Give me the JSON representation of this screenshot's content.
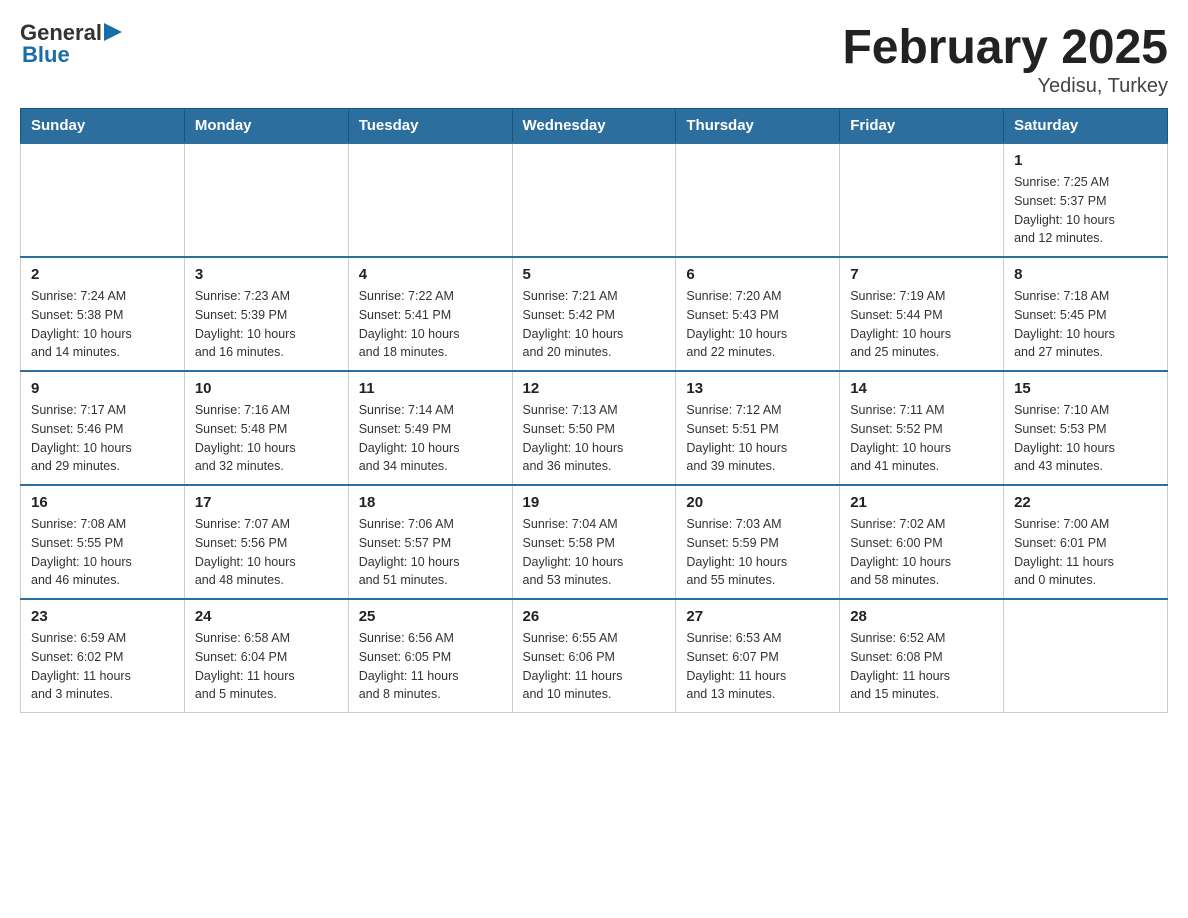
{
  "header": {
    "logo": {
      "general": "General",
      "blue": "Blue",
      "arrow": "▶"
    },
    "title": "February 2025",
    "subtitle": "Yedisu, Turkey"
  },
  "calendar": {
    "days_of_week": [
      "Sunday",
      "Monday",
      "Tuesday",
      "Wednesday",
      "Thursday",
      "Friday",
      "Saturday"
    ],
    "weeks": [
      {
        "days": [
          {
            "number": "",
            "info": ""
          },
          {
            "number": "",
            "info": ""
          },
          {
            "number": "",
            "info": ""
          },
          {
            "number": "",
            "info": ""
          },
          {
            "number": "",
            "info": ""
          },
          {
            "number": "",
            "info": ""
          },
          {
            "number": "1",
            "info": "Sunrise: 7:25 AM\nSunset: 5:37 PM\nDaylight: 10 hours\nand 12 minutes."
          }
        ]
      },
      {
        "days": [
          {
            "number": "2",
            "info": "Sunrise: 7:24 AM\nSunset: 5:38 PM\nDaylight: 10 hours\nand 14 minutes."
          },
          {
            "number": "3",
            "info": "Sunrise: 7:23 AM\nSunset: 5:39 PM\nDaylight: 10 hours\nand 16 minutes."
          },
          {
            "number": "4",
            "info": "Sunrise: 7:22 AM\nSunset: 5:41 PM\nDaylight: 10 hours\nand 18 minutes."
          },
          {
            "number": "5",
            "info": "Sunrise: 7:21 AM\nSunset: 5:42 PM\nDaylight: 10 hours\nand 20 minutes."
          },
          {
            "number": "6",
            "info": "Sunrise: 7:20 AM\nSunset: 5:43 PM\nDaylight: 10 hours\nand 22 minutes."
          },
          {
            "number": "7",
            "info": "Sunrise: 7:19 AM\nSunset: 5:44 PM\nDaylight: 10 hours\nand 25 minutes."
          },
          {
            "number": "8",
            "info": "Sunrise: 7:18 AM\nSunset: 5:45 PM\nDaylight: 10 hours\nand 27 minutes."
          }
        ]
      },
      {
        "days": [
          {
            "number": "9",
            "info": "Sunrise: 7:17 AM\nSunset: 5:46 PM\nDaylight: 10 hours\nand 29 minutes."
          },
          {
            "number": "10",
            "info": "Sunrise: 7:16 AM\nSunset: 5:48 PM\nDaylight: 10 hours\nand 32 minutes."
          },
          {
            "number": "11",
            "info": "Sunrise: 7:14 AM\nSunset: 5:49 PM\nDaylight: 10 hours\nand 34 minutes."
          },
          {
            "number": "12",
            "info": "Sunrise: 7:13 AM\nSunset: 5:50 PM\nDaylight: 10 hours\nand 36 minutes."
          },
          {
            "number": "13",
            "info": "Sunrise: 7:12 AM\nSunset: 5:51 PM\nDaylight: 10 hours\nand 39 minutes."
          },
          {
            "number": "14",
            "info": "Sunrise: 7:11 AM\nSunset: 5:52 PM\nDaylight: 10 hours\nand 41 minutes."
          },
          {
            "number": "15",
            "info": "Sunrise: 7:10 AM\nSunset: 5:53 PM\nDaylight: 10 hours\nand 43 minutes."
          }
        ]
      },
      {
        "days": [
          {
            "number": "16",
            "info": "Sunrise: 7:08 AM\nSunset: 5:55 PM\nDaylight: 10 hours\nand 46 minutes."
          },
          {
            "number": "17",
            "info": "Sunrise: 7:07 AM\nSunset: 5:56 PM\nDaylight: 10 hours\nand 48 minutes."
          },
          {
            "number": "18",
            "info": "Sunrise: 7:06 AM\nSunset: 5:57 PM\nDaylight: 10 hours\nand 51 minutes."
          },
          {
            "number": "19",
            "info": "Sunrise: 7:04 AM\nSunset: 5:58 PM\nDaylight: 10 hours\nand 53 minutes."
          },
          {
            "number": "20",
            "info": "Sunrise: 7:03 AM\nSunset: 5:59 PM\nDaylight: 10 hours\nand 55 minutes."
          },
          {
            "number": "21",
            "info": "Sunrise: 7:02 AM\nSunset: 6:00 PM\nDaylight: 10 hours\nand 58 minutes."
          },
          {
            "number": "22",
            "info": "Sunrise: 7:00 AM\nSunset: 6:01 PM\nDaylight: 11 hours\nand 0 minutes."
          }
        ]
      },
      {
        "days": [
          {
            "number": "23",
            "info": "Sunrise: 6:59 AM\nSunset: 6:02 PM\nDaylight: 11 hours\nand 3 minutes."
          },
          {
            "number": "24",
            "info": "Sunrise: 6:58 AM\nSunset: 6:04 PM\nDaylight: 11 hours\nand 5 minutes."
          },
          {
            "number": "25",
            "info": "Sunrise: 6:56 AM\nSunset: 6:05 PM\nDaylight: 11 hours\nand 8 minutes."
          },
          {
            "number": "26",
            "info": "Sunrise: 6:55 AM\nSunset: 6:06 PM\nDaylight: 11 hours\nand 10 minutes."
          },
          {
            "number": "27",
            "info": "Sunrise: 6:53 AM\nSunset: 6:07 PM\nDaylight: 11 hours\nand 13 minutes."
          },
          {
            "number": "28",
            "info": "Sunrise: 6:52 AM\nSunset: 6:08 PM\nDaylight: 11 hours\nand 15 minutes."
          },
          {
            "number": "",
            "info": ""
          }
        ]
      }
    ]
  }
}
